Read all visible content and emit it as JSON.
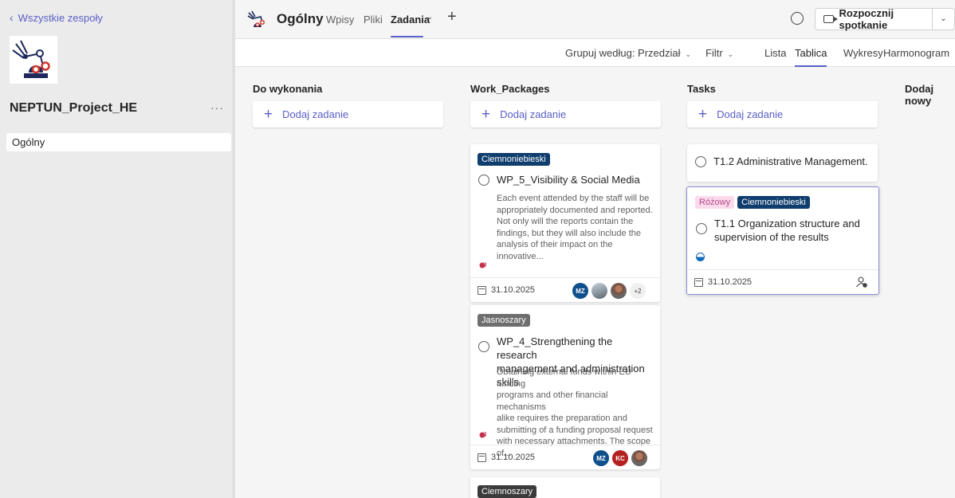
{
  "sidebar": {
    "back_label": "Wszystkie zespoły",
    "team_name": "NEPTUN_Project_HE",
    "more": "···",
    "channels": [
      {
        "label": "Ogólny"
      }
    ]
  },
  "header": {
    "channel_title": "Ogólny",
    "tabs": [
      {
        "label": "Wpisy"
      },
      {
        "label": "Pliki"
      },
      {
        "label": "Zadania",
        "active": true
      }
    ],
    "meet_label": "Rozpocznij spotkanie"
  },
  "toolbar": {
    "group_by": "Grupuj według: Przedział",
    "filter": "Filtr",
    "views": [
      {
        "label": "Lista"
      },
      {
        "label": "Tablica",
        "active": true
      },
      {
        "label": "Wykresy"
      },
      {
        "label": "Harmonogram"
      }
    ]
  },
  "board": {
    "add_task_label": "Dodaj zadanie",
    "buckets": [
      {
        "title": "Do wykonania"
      },
      {
        "title": "Work_Packages"
      },
      {
        "title": "Tasks"
      },
      {
        "title": "Dodaj nowy"
      }
    ],
    "cards": [
      {
        "labels": [
          "Ciemnoniebieski"
        ],
        "title": "WP_5_Visibility & Social Media",
        "description": [
          "Each event attended by the staff will be",
          "appropriately documented and reported.",
          "Not only will the reports contain the",
          "findings, but they will also include the",
          "analysis of their impact on the innovative..."
        ],
        "date": "31.10.2025",
        "avatars": [
          "MZ",
          "",
          "",
          "+2"
        ]
      },
      {
        "labels": [
          "Jasnoszary"
        ],
        "title": [
          "WP_4_Strengthening the research",
          "management and administration skills"
        ],
        "description": [
          "Obtaining external funds within EU funding",
          "programs and other financial mechanisms",
          "alike requires the preparation and",
          "submitting of a funding proposal request",
          "with necessary attachments. The scope of..."
        ],
        "date": "31.10.2025",
        "avatars": [
          "MZ",
          "KC",
          ""
        ]
      },
      {
        "labels": [
          "Ciemnoszary"
        ]
      },
      {
        "title": "T1.2 Administrative Management."
      },
      {
        "labels": [
          "Różowy",
          "Ciemnoniebieski"
        ],
        "title": [
          "T1.1 Organization structure and",
          "supervision of the results"
        ],
        "date": "31.10.2025"
      }
    ]
  },
  "colors": {
    "accent": "#5b5fc7",
    "label_navy": "#0f3d6e",
    "label_grey": "#6e6e6e",
    "label_pink_bg": "#fbdaec",
    "label_dark": "#3b3b3b"
  },
  "icons": [
    "chevron-left-icon",
    "more-icon",
    "add-tab-icon",
    "chat-icon",
    "video-camera-icon",
    "chevron-down-icon",
    "plus-icon",
    "circle-checkbox-icon",
    "attachment-icon",
    "calendar-icon",
    "progress-icon",
    "assign-icon"
  ]
}
